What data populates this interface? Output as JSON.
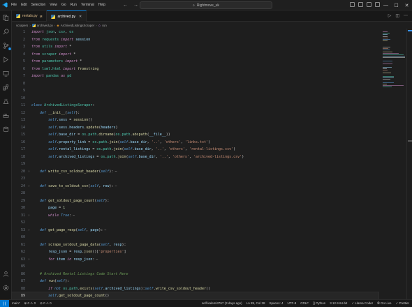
{
  "menu": [
    "File",
    "Edit",
    "Selection",
    "View",
    "Go",
    "Run",
    "Terminal",
    "Help"
  ],
  "command_center": "Rightmove_uk",
  "tabs": [
    {
      "name": "rentals.py",
      "badge": "M",
      "active": false
    },
    {
      "name": "archived.py",
      "badge": "",
      "active": true
    }
  ],
  "breadcrumb": [
    "scrapers",
    "archived.py",
    "ArchivedListingsScraper",
    "run"
  ],
  "lines": [
    {
      "n": "1",
      "fold": "",
      "parts": [
        [
          "kw",
          "import"
        ],
        [
          "plain",
          " "
        ],
        [
          "mod",
          "json"
        ],
        [
          "plain",
          ", "
        ],
        [
          "mod",
          "csv"
        ],
        [
          "plain",
          ", "
        ],
        [
          "mod",
          "os"
        ]
      ]
    },
    {
      "n": "2",
      "fold": "",
      "parts": [
        [
          "kw",
          "from"
        ],
        [
          "plain",
          " "
        ],
        [
          "mod",
          "requests"
        ],
        [
          "plain",
          " "
        ],
        [
          "kw",
          "import"
        ],
        [
          "plain",
          " "
        ],
        [
          "var",
          "session"
        ]
      ]
    },
    {
      "n": "3",
      "fold": "",
      "parts": [
        [
          "kw",
          "from"
        ],
        [
          "plain",
          " "
        ],
        [
          "mod",
          "utils"
        ],
        [
          "plain",
          " "
        ],
        [
          "kw",
          "import"
        ],
        [
          "plain",
          " *"
        ]
      ]
    },
    {
      "n": "4",
      "fold": "",
      "parts": [
        [
          "kw",
          "from"
        ],
        [
          "plain",
          " "
        ],
        [
          "mod",
          "scraper"
        ],
        [
          "plain",
          " "
        ],
        [
          "kw",
          "import"
        ],
        [
          "plain",
          " *"
        ]
      ]
    },
    {
      "n": "5",
      "fold": "",
      "parts": [
        [
          "kw",
          "from"
        ],
        [
          "plain",
          " "
        ],
        [
          "mod",
          "parameters"
        ],
        [
          "plain",
          " "
        ],
        [
          "kw",
          "import"
        ],
        [
          "plain",
          " *"
        ]
      ]
    },
    {
      "n": "6",
      "fold": "",
      "parts": [
        [
          "kw",
          "from"
        ],
        [
          "plain",
          " "
        ],
        [
          "mod",
          "lxml.html"
        ],
        [
          "plain",
          " "
        ],
        [
          "kw",
          "import"
        ],
        [
          "plain",
          " "
        ],
        [
          "fn",
          "fromstring"
        ]
      ]
    },
    {
      "n": "7",
      "fold": "",
      "parts": [
        [
          "kw",
          "import"
        ],
        [
          "plain",
          " "
        ],
        [
          "mod",
          "pandas"
        ],
        [
          "plain",
          " "
        ],
        [
          "kw",
          "as"
        ],
        [
          "plain",
          " "
        ],
        [
          "mod",
          "pd"
        ]
      ]
    },
    {
      "n": "8",
      "fold": "",
      "parts": []
    },
    {
      "n": "9",
      "fold": "",
      "parts": []
    },
    {
      "n": "10",
      "fold": "",
      "parts": []
    },
    {
      "n": "11",
      "fold": "",
      "parts": [
        [
          "def",
          "class"
        ],
        [
          "plain",
          " "
        ],
        [
          "cls",
          "ArchivedListingsScraper"
        ],
        [
          "plain",
          ":"
        ]
      ]
    },
    {
      "n": "12",
      "fold": "",
      "parts": [
        [
          "plain",
          "    "
        ],
        [
          "def",
          "def"
        ],
        [
          "plain",
          " "
        ],
        [
          "fn",
          "__init__"
        ],
        [
          "plain",
          "("
        ],
        [
          "self",
          "self"
        ],
        [
          "plain",
          "):"
        ]
      ]
    },
    {
      "n": "13",
      "fold": "",
      "parts": [
        [
          "plain",
          "        "
        ],
        [
          "self",
          "self"
        ],
        [
          "plain",
          "."
        ],
        [
          "var",
          "sess"
        ],
        [
          "plain",
          " = "
        ],
        [
          "fn",
          "session"
        ],
        [
          "plain",
          "()"
        ]
      ]
    },
    {
      "n": "14",
      "fold": "",
      "parts": [
        [
          "plain",
          "        "
        ],
        [
          "self",
          "self"
        ],
        [
          "plain",
          "."
        ],
        [
          "var",
          "sess"
        ],
        [
          "plain",
          "."
        ],
        [
          "var",
          "headers"
        ],
        [
          "plain",
          "."
        ],
        [
          "fn",
          "update"
        ],
        [
          "plain",
          "("
        ],
        [
          "var",
          "headers"
        ],
        [
          "plain",
          ")"
        ]
      ]
    },
    {
      "n": "15",
      "fold": "",
      "parts": [
        [
          "plain",
          "        "
        ],
        [
          "self",
          "self"
        ],
        [
          "plain",
          "."
        ],
        [
          "var",
          "base_dir"
        ],
        [
          "plain",
          " = "
        ],
        [
          "mod",
          "os"
        ],
        [
          "plain",
          "."
        ],
        [
          "mod",
          "path"
        ],
        [
          "plain",
          "."
        ],
        [
          "fn",
          "dirname"
        ],
        [
          "plain",
          "("
        ],
        [
          "mod",
          "os"
        ],
        [
          "plain",
          "."
        ],
        [
          "mod",
          "path"
        ],
        [
          "plain",
          "."
        ],
        [
          "fn",
          "abspath"
        ],
        [
          "plain",
          "("
        ],
        [
          "var",
          "__file__"
        ],
        [
          "plain",
          "))"
        ]
      ]
    },
    {
      "n": "16",
      "fold": "",
      "parts": [
        [
          "plain",
          "        "
        ],
        [
          "self",
          "self"
        ],
        [
          "plain",
          "."
        ],
        [
          "var",
          "property_link"
        ],
        [
          "plain",
          " = "
        ],
        [
          "mod",
          "os"
        ],
        [
          "plain",
          "."
        ],
        [
          "mod",
          "path"
        ],
        [
          "plain",
          "."
        ],
        [
          "fn",
          "join"
        ],
        [
          "plain",
          "("
        ],
        [
          "self",
          "self"
        ],
        [
          "plain",
          "."
        ],
        [
          "var",
          "base_dir"
        ],
        [
          "plain",
          ", "
        ],
        [
          "str",
          "'..'"
        ],
        [
          "plain",
          ", "
        ],
        [
          "str",
          "'others'"
        ],
        [
          "plain",
          ", "
        ],
        [
          "str",
          "'links.txt'"
        ],
        [
          "plain",
          ")"
        ]
      ]
    },
    {
      "n": "17",
      "fold": "",
      "parts": [
        [
          "plain",
          "        "
        ],
        [
          "self",
          "self"
        ],
        [
          "plain",
          "."
        ],
        [
          "var",
          "rental_listings"
        ],
        [
          "plain",
          " = "
        ],
        [
          "mod",
          "os"
        ],
        [
          "plain",
          "."
        ],
        [
          "mod",
          "path"
        ],
        [
          "plain",
          "."
        ],
        [
          "fn",
          "join"
        ],
        [
          "plain",
          "("
        ],
        [
          "self",
          "self"
        ],
        [
          "plain",
          "."
        ],
        [
          "var",
          "base_dir"
        ],
        [
          "plain",
          ", "
        ],
        [
          "str",
          "'..'"
        ],
        [
          "plain",
          ", "
        ],
        [
          "str",
          "'others'"
        ],
        [
          "plain",
          ", "
        ],
        [
          "str",
          "'rental-listings.csv'"
        ],
        [
          "plain",
          ")"
        ]
      ]
    },
    {
      "n": "18",
      "fold": "",
      "parts": [
        [
          "plain",
          "        "
        ],
        [
          "self",
          "self"
        ],
        [
          "plain",
          "."
        ],
        [
          "var",
          "archived_listings"
        ],
        [
          "plain",
          " = "
        ],
        [
          "mod",
          "os"
        ],
        [
          "plain",
          "."
        ],
        [
          "mod",
          "path"
        ],
        [
          "plain",
          "."
        ],
        [
          "fn",
          "join"
        ],
        [
          "plain",
          "("
        ],
        [
          "self",
          "self"
        ],
        [
          "plain",
          "."
        ],
        [
          "var",
          "base_dir"
        ],
        [
          "plain",
          ", "
        ],
        [
          "str",
          "'..'"
        ],
        [
          "plain",
          ", "
        ],
        [
          "str",
          "'others'"
        ],
        [
          "plain",
          ", "
        ],
        [
          "str",
          "'archived-listings.csv'"
        ],
        [
          "plain",
          ")"
        ]
      ]
    },
    {
      "n": "19",
      "fold": "",
      "parts": []
    },
    {
      "n": "20",
      "fold": ">",
      "folded": true,
      "parts": [
        [
          "plain",
          "    "
        ],
        [
          "def",
          "def"
        ],
        [
          "plain",
          " "
        ],
        [
          "fn",
          "write_csv_soldout_header"
        ],
        [
          "plain",
          "("
        ],
        [
          "self",
          "self"
        ],
        [
          "plain",
          "):"
        ]
      ]
    },
    {
      "n": "23",
      "fold": "",
      "parts": []
    },
    {
      "n": "24",
      "fold": ">",
      "folded": true,
      "parts": [
        [
          "plain",
          "    "
        ],
        [
          "def",
          "def"
        ],
        [
          "plain",
          " "
        ],
        [
          "fn",
          "save_to_soldout_csv"
        ],
        [
          "plain",
          "("
        ],
        [
          "self",
          "self"
        ],
        [
          "plain",
          ", "
        ],
        [
          "var",
          "row"
        ],
        [
          "plain",
          "):"
        ]
      ]
    },
    {
      "n": "28",
      "fold": "",
      "parts": []
    },
    {
      "n": "29",
      "fold": "",
      "parts": [
        [
          "plain",
          "    "
        ],
        [
          "def",
          "def"
        ],
        [
          "plain",
          " "
        ],
        [
          "fn",
          "get_soldout_page_count"
        ],
        [
          "plain",
          "("
        ],
        [
          "self",
          "self"
        ],
        [
          "plain",
          "):"
        ]
      ]
    },
    {
      "n": "30",
      "fold": "",
      "parts": [
        [
          "plain",
          "        "
        ],
        [
          "var",
          "page"
        ],
        [
          "plain",
          " = "
        ],
        [
          "num",
          "1"
        ]
      ]
    },
    {
      "n": "31",
      "fold": ">",
      "folded": true,
      "parts": [
        [
          "plain",
          "        "
        ],
        [
          "kw",
          "while"
        ],
        [
          "plain",
          " "
        ],
        [
          "def",
          "True"
        ],
        [
          "plain",
          ":"
        ]
      ]
    },
    {
      "n": "52",
      "fold": "",
      "parts": []
    },
    {
      "n": "53",
      "fold": ">",
      "folded": true,
      "parts": [
        [
          "plain",
          "    "
        ],
        [
          "def",
          "def"
        ],
        [
          "plain",
          " "
        ],
        [
          "fn",
          "get_page_resp"
        ],
        [
          "plain",
          "("
        ],
        [
          "self",
          "self"
        ],
        [
          "plain",
          ", "
        ],
        [
          "var",
          "page"
        ],
        [
          "plain",
          "):"
        ]
      ]
    },
    {
      "n": "60",
      "fold": "",
      "parts": []
    },
    {
      "n": "61",
      "fold": "",
      "parts": [
        [
          "plain",
          "    "
        ],
        [
          "def",
          "def"
        ],
        [
          "plain",
          " "
        ],
        [
          "fn",
          "scrape_soldout_page_data"
        ],
        [
          "plain",
          "("
        ],
        [
          "self",
          "self"
        ],
        [
          "plain",
          ", "
        ],
        [
          "var",
          "resp"
        ],
        [
          "plain",
          "):"
        ]
      ]
    },
    {
      "n": "62",
      "fold": "",
      "parts": [
        [
          "plain",
          "        "
        ],
        [
          "var",
          "resp_json"
        ],
        [
          "plain",
          " = "
        ],
        [
          "var",
          "resp"
        ],
        [
          "plain",
          "."
        ],
        [
          "fn",
          "json"
        ],
        [
          "plain",
          "()["
        ],
        [
          "str",
          "'properties'"
        ],
        [
          "plain",
          "]"
        ]
      ]
    },
    {
      "n": "63",
      "fold": ">",
      "folded": true,
      "parts": [
        [
          "plain",
          "        "
        ],
        [
          "kw",
          "for"
        ],
        [
          "plain",
          " "
        ],
        [
          "var",
          "item"
        ],
        [
          "plain",
          " "
        ],
        [
          "kw",
          "in"
        ],
        [
          "plain",
          " "
        ],
        [
          "var",
          "resp_json"
        ],
        [
          "plain",
          ":"
        ]
      ]
    },
    {
      "n": "85",
      "fold": "",
      "parts": []
    },
    {
      "n": "86",
      "fold": "",
      "parts": [
        [
          "plain",
          "    "
        ],
        [
          "com",
          "# Archived Rental Listings Code Start Here"
        ]
      ]
    },
    {
      "n": "87",
      "fold": "",
      "parts": [
        [
          "plain",
          "    "
        ],
        [
          "def",
          "def"
        ],
        [
          "plain",
          " "
        ],
        [
          "fn",
          "run"
        ],
        [
          "plain",
          "("
        ],
        [
          "self",
          "self"
        ],
        [
          "plain",
          "):"
        ]
      ]
    },
    {
      "n": "88",
      "fold": "",
      "parts": [
        [
          "plain",
          "        "
        ],
        [
          "kw",
          "if"
        ],
        [
          "plain",
          " "
        ],
        [
          "def",
          "not"
        ],
        [
          "plain",
          " "
        ],
        [
          "mod",
          "os"
        ],
        [
          "plain",
          "."
        ],
        [
          "mod",
          "path"
        ],
        [
          "plain",
          "."
        ],
        [
          "fn",
          "exists"
        ],
        [
          "plain",
          "("
        ],
        [
          "self",
          "self"
        ],
        [
          "plain",
          "."
        ],
        [
          "var",
          "archived_listings"
        ],
        [
          "plain",
          "):"
        ],
        [
          "self",
          "self"
        ],
        [
          "plain",
          "."
        ],
        [
          "fn",
          "write_csv_soldout_header"
        ],
        [
          "plain",
          "()"
        ]
      ]
    },
    {
      "n": "89",
      "fold": "",
      "current": true,
      "parts": [
        [
          "plain",
          "        "
        ],
        [
          "self",
          "self"
        ],
        [
          "plain",
          "."
        ],
        [
          "fn",
          "get_soldout_page_count"
        ],
        [
          "plain",
          "()"
        ]
      ]
    }
  ],
  "status_left": [
    "main*",
    "⊗ 0 ⚠ 0",
    "⊘ 0 ⚠ 0"
  ],
  "status_right": [
    "self-kalemi3767 (3 days ago)",
    "Ln 89, Col 38",
    "Spaces: 4",
    "UTF-8",
    "CRLF",
    "{} Python",
    "3.12.9 64-bit",
    "✓ Llama Coder",
    "⦾ Go Live",
    "✓ Prettier"
  ],
  "colors": {
    "accent": "#0078d4",
    "editor_bg": "#1e1e1e",
    "status_bg": "#181818"
  }
}
